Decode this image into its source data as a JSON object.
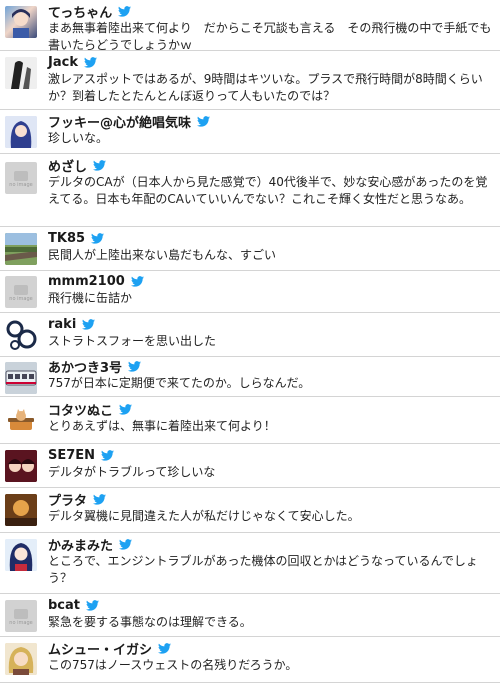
{
  "colors": {
    "bird": "#1da1f2",
    "divider": "#d4d4d4"
  },
  "placeholder_label": "no image",
  "tweets": [
    {
      "name": "てっちゃん",
      "avatar_icon": "anime-avatar-icon",
      "text": "まあ無事着陸出来て何より　だからこそ冗談も言える　その飛行機の中で手紙でも書いたらどうでしょうかｗ"
    },
    {
      "name": "Jack",
      "avatar_icon": "bw-portrait-avatar-icon",
      "text": "激レアスポットではあるが、9時間はキツいな。プラスで飛行時間が8時間くらいか？到着したとたんとんぼ返りって人もいたのでは？"
    },
    {
      "name": "フッキー@心が絶唱気味",
      "avatar_icon": "anime-girl-avatar-icon",
      "text": "珍しいな。"
    },
    {
      "name": "めざし",
      "avatar_icon": "no-image-avatar-icon",
      "text": "デルタのCAが（日本人から見た感覚で）40代後半で、妙な安心感があったのを覚えてる。日本も年配のCAいていいんでない？これこそ輝く女性だと思うなあ。"
    },
    {
      "name": "TK85",
      "avatar_icon": "train-avatar-icon",
      "text": "民間人が上陸出来ない島だもんな、すごい"
    },
    {
      "name": "mmm2100",
      "avatar_icon": "no-image-avatar-icon",
      "text": "飛行機に缶詰か"
    },
    {
      "name": "raki",
      "avatar_icon": "circles-avatar-icon",
      "text": "ストラトスフォーを思い出した"
    },
    {
      "name": "あかつき3号",
      "avatar_icon": "train-avatar-icon",
      "text": "757が日本に定期便で来てたのか。しらなんだ。"
    },
    {
      "name": "コタツぬこ",
      "avatar_icon": "cat-avatar-icon",
      "text": "とりあえずは、無事に着陸出来て何より！"
    },
    {
      "name": "SE7EN",
      "avatar_icon": "anime-avatar-icon",
      "text": "デルタがトラブルって珍しいな"
    },
    {
      "name": "プラタ",
      "avatar_icon": "photo-avatar-icon",
      "text": "デルタ翼機に見間違えた人が私だけじゃなくて安心した。"
    },
    {
      "name": "かみまみた",
      "avatar_icon": "anime-girl-avatar-icon",
      "text": "ところで、エンジントラブルがあった機体の回収とかはどうなっているんでしょう？"
    },
    {
      "name": "bcat",
      "avatar_icon": "no-image-avatar-icon",
      "text": "緊急を要する事態なのは理解できる。"
    },
    {
      "name": "ムシュー・イガシ",
      "avatar_icon": "blonde-avatar-icon",
      "text": "この757はノースウェストの名残りだろうか。"
    }
  ]
}
